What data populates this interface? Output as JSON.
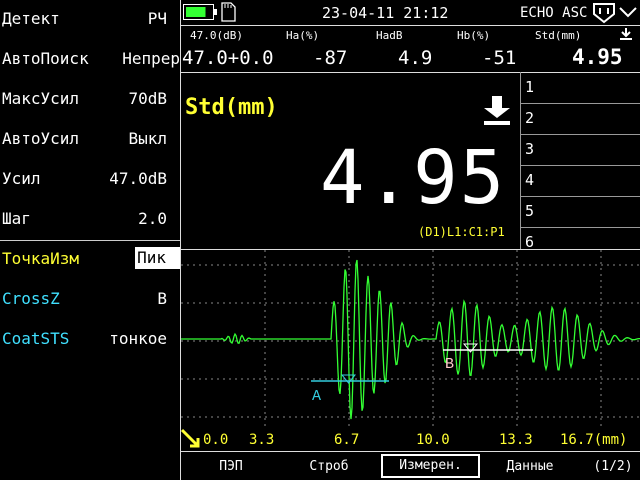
{
  "menu": [
    {
      "label": "Детект",
      "value": "РЧ"
    },
    {
      "label": "АвтоПоиск",
      "value": "Непрер"
    },
    {
      "label": "МаксУсил",
      "value": "70dB"
    },
    {
      "label": "АвтоУсил",
      "value": "Выкл"
    },
    {
      "label": "Усил",
      "value": "47.0dB"
    },
    {
      "label": "Шаг",
      "value": "2.0"
    },
    {
      "label": "ТочкаИзм",
      "value": "Пик"
    },
    {
      "label": "CrossZ",
      "value": "В"
    },
    {
      "label": "CoatSTS",
      "value": "тонкое"
    }
  ],
  "status": {
    "datetime": "23-04-11 21:12",
    "mode": "ECHO ASC",
    "battery_level": 0.75
  },
  "measure": {
    "headers": [
      "47.0(dB)",
      "Ha(%)",
      "HadB",
      "Hb(%)",
      "Std(mm)"
    ],
    "values": [
      "47.0+0.0",
      "-87",
      "4.9",
      "-51",
      "4.95"
    ]
  },
  "main": {
    "label": "Std(mm)",
    "value": "4.95",
    "info": "(D1)L1:C1:P1",
    "slots": [
      "1",
      "2",
      "3",
      "4",
      "5",
      "6"
    ]
  },
  "scan": {
    "gate_a_label": "A",
    "gate_b_label": "B",
    "ticks": [
      "0.0",
      "3.3",
      "6.7",
      "10.0",
      "13.3",
      "16.7(mm)"
    ]
  },
  "bottom": {
    "tabs": [
      "ПЭП",
      "Строб",
      "Измерен.",
      "Данные"
    ],
    "page": "(1/2)"
  },
  "colors": {
    "accent": "#ffff33",
    "wave": "#33ff33",
    "gate_a": "#33ccdd",
    "gate_b": "#ffffff",
    "label_dim": "#40e0ff"
  }
}
